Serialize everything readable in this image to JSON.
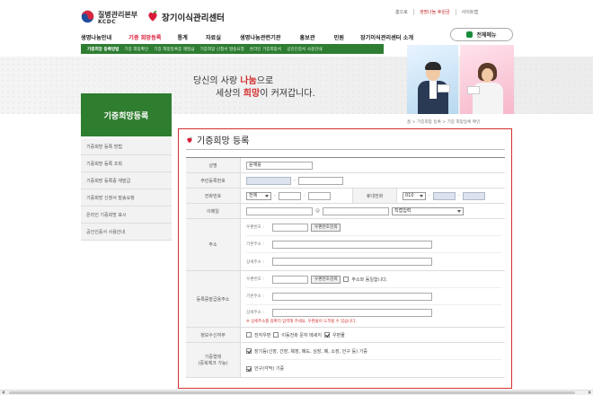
{
  "header": {
    "org_name": "질병관리본부",
    "org_abbr": "KCDC",
    "center_name": "장기이식관리센터",
    "util_links": [
      "홈으로",
      "생명나눔 후원금",
      "사이트맵"
    ],
    "gnb": [
      "생명나눔안내",
      "기증 희망등록",
      "통계",
      "자료실",
      "생명나눔관련기관",
      "홍보관",
      "민원",
      "장기이식관리센터 소개"
    ],
    "gnb_active": "기증 희망등록",
    "all_menu": "전체메뉴",
    "subnav": [
      "기증희망 등록방법",
      "기증 희망확인",
      "기증 희망등록증 재발급",
      "기증희망 신청서 발송요청",
      "온라인 기증희망서",
      "공인인증서 사용안내"
    ],
    "subnav_active": "기증희망 등록방법"
  },
  "banner": {
    "line1_pre": "당신의 사랑 ",
    "line1_accent": "나눔",
    "line1_post": "으로",
    "line2_pre": "세상의 ",
    "line2_accent": "희망",
    "line2_post": "이 커져갑니다."
  },
  "sidebar": {
    "title": "기증희망등록",
    "items": [
      "기증희망 등록 방법",
      "기증희망 등록 조회",
      "기증희망 등록증 재발급",
      "기증희망 신청서 발송요청",
      "온라인 기증희망 표시",
      "공인인증서 사용안내"
    ]
  },
  "breadcrumb": "홈 > 기증희망 등록 > 기증 희망등록 확인",
  "page_title": "기증희망 등록",
  "form": {
    "name_label": "성명",
    "name_value": "윤재웅",
    "rrn_label": "주민등록번호",
    "phone_label": "전화번호",
    "phone_area": "전체",
    "mobile_label": "휴대전화",
    "mobile_prefix": "010",
    "email_label": "이메일",
    "email_at": "@",
    "email_domain": "직접입력",
    "addr_label": "주소",
    "zip_label": "우편번호 :",
    "zip_button": "우편번호검색",
    "addr1_label": "기본주소 :",
    "addr2_label": "상세주소 :",
    "card_addr_label": "등록증발급용주소",
    "card_zip_button": "우편번호검색",
    "same_addr_label": "주소와 동일합니다.",
    "card_addr1_label": "기본주소 :",
    "card_addr2_label": "상세주소 :",
    "card_note": "※ 상세주소를 정확히 입력해 주세요. 우편물이 도착될 수 있습니다.",
    "receive_label": "정보수신여부",
    "receive_options": [
      {
        "label": "전자우편",
        "checked": false
      },
      {
        "label": "이동전화 문자 메세지",
        "checked": false
      },
      {
        "label": "우편물",
        "checked": true
      }
    ],
    "donation_label_1": "기증형태",
    "donation_label_2": "(중복체크 가능)",
    "donation_options": [
      {
        "label": "장기등(신장, 간장, 췌장, 폐도, 심장, 폐, 소장, 안구 등) 기증",
        "checked": true
      },
      {
        "label": "안구(각막) 기증",
        "checked": true
      }
    ]
  }
}
